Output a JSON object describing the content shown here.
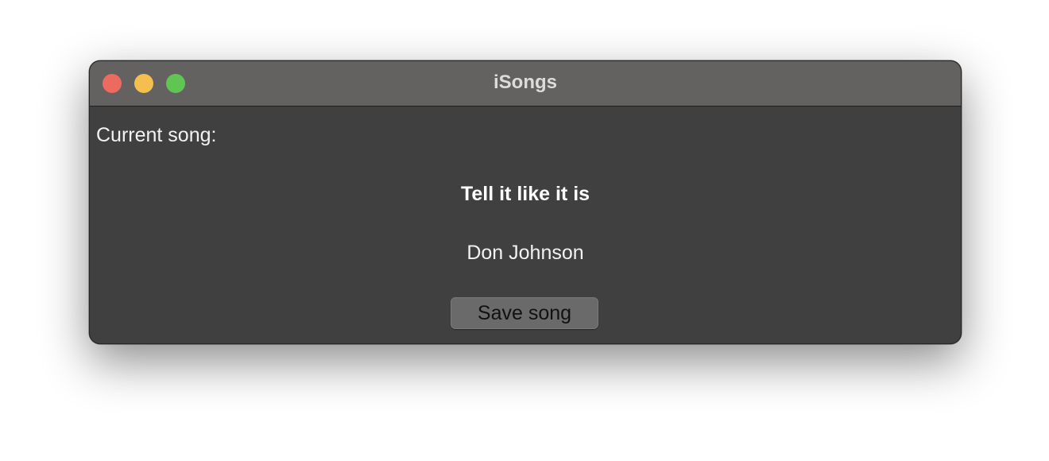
{
  "window": {
    "title": "iSongs"
  },
  "content": {
    "current_label": "Current song:",
    "song_title": "Tell it like it is",
    "artist": "Don Johnson",
    "save_button_label": "Save song"
  },
  "colors": {
    "close": "#ec6a5e",
    "minimize": "#f4bf4f",
    "zoom": "#61c554",
    "window_bg": "#404040",
    "titlebar_bg": "#646261"
  }
}
